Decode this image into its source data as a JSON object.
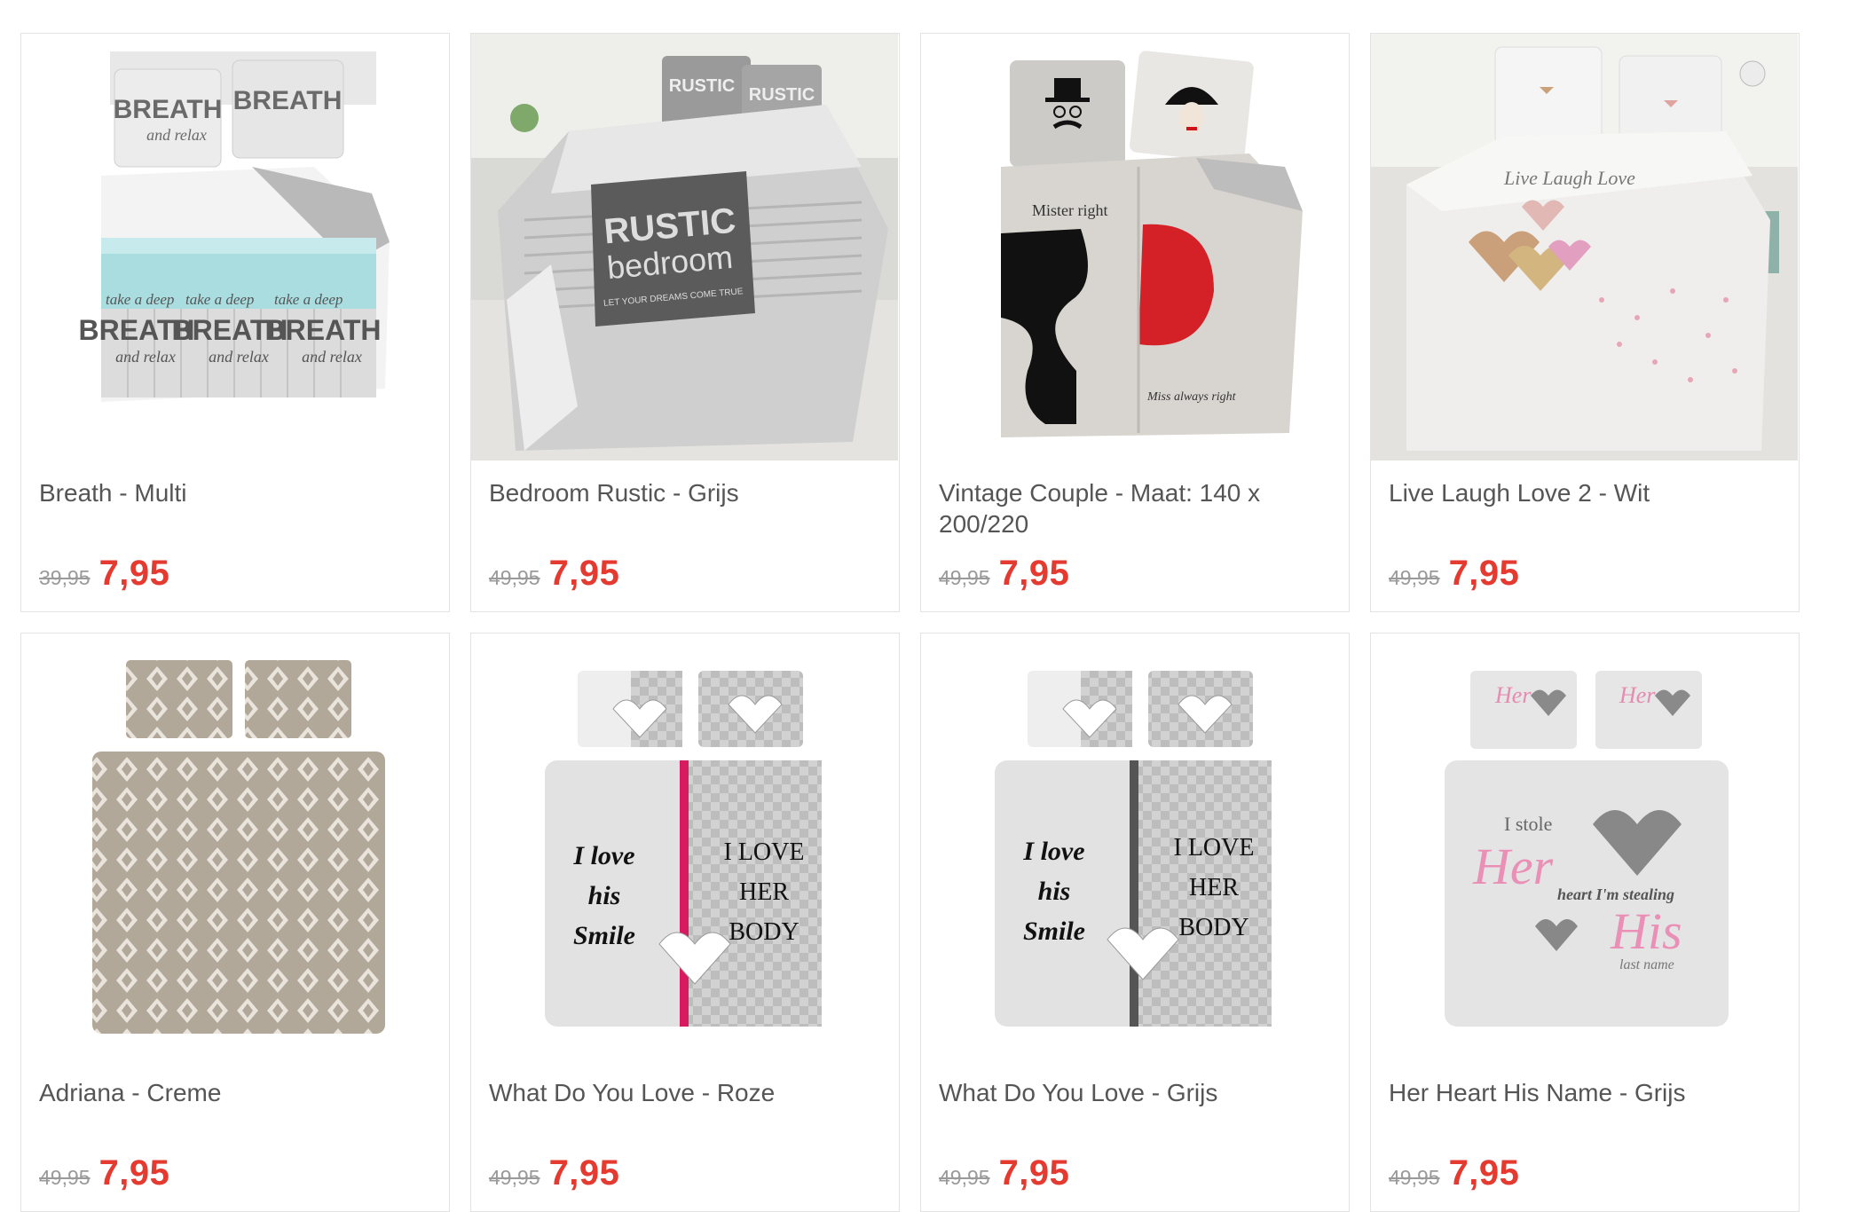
{
  "colors": {
    "price_accent": "#e43a30",
    "old_price": "#9a9a9a",
    "title": "#555555",
    "border": "#e3e3e3"
  },
  "products": [
    {
      "title": "Breath - Multi",
      "old_price": "39,95",
      "price": "7,95",
      "image": {
        "icon": "duvet-cover-breath-print",
        "text_1": "BREATH",
        "text_2": "and relax",
        "text_3": "take a deep"
      }
    },
    {
      "title": "Bedroom Rustic - Grijs",
      "old_price": "49,95",
      "price": "7,95",
      "image": {
        "icon": "duvet-cover-rustic-bedroom",
        "text_1": "RUSTIC",
        "text_2": "bedroom",
        "text_3": "LET YOUR DREAMS COME TRUE"
      }
    },
    {
      "title": "Vintage Couple - Maat: 140 x 200/220",
      "old_price": "49,95",
      "price": "7,95",
      "image": {
        "icon": "duvet-cover-vintage-couple",
        "text_1": "Mister right",
        "text_2": "Miss always right"
      }
    },
    {
      "title": "Live Laugh Love 2 - Wit",
      "old_price": "49,95",
      "price": "7,95",
      "image": {
        "icon": "duvet-cover-hearts",
        "text_1": "Live Laugh Love"
      }
    },
    {
      "title": "Adriana - Creme",
      "old_price": "49,95",
      "price": "7,95",
      "image": {
        "icon": "duvet-cover-damask"
      }
    },
    {
      "title": "What Do You Love - Roze",
      "old_price": "49,95",
      "price": "7,95",
      "image": {
        "icon": "duvet-cover-love-pink",
        "text_1": "I love",
        "text_2": "his",
        "text_3": "Smile",
        "text_4": "I LOVE",
        "text_5": "HER",
        "text_6": "BODY",
        "stripe": "#d81b60"
      }
    },
    {
      "title": "What Do You Love - Grijs",
      "old_price": "49,95",
      "price": "7,95",
      "image": {
        "icon": "duvet-cover-love-grey",
        "text_1": "I love",
        "text_2": "his",
        "text_3": "Smile",
        "text_4": "I LOVE",
        "text_5": "HER",
        "text_6": "BODY",
        "stripe": "#555555"
      }
    },
    {
      "title": "Her Heart His Name - Grijs",
      "old_price": "49,95",
      "price": "7,95",
      "image": {
        "icon": "duvet-cover-her-heart",
        "text_1": "I stole",
        "text_2": "Her",
        "text_3": "heart I'm stealing",
        "text_4": "His",
        "text_5": "last name"
      }
    }
  ]
}
